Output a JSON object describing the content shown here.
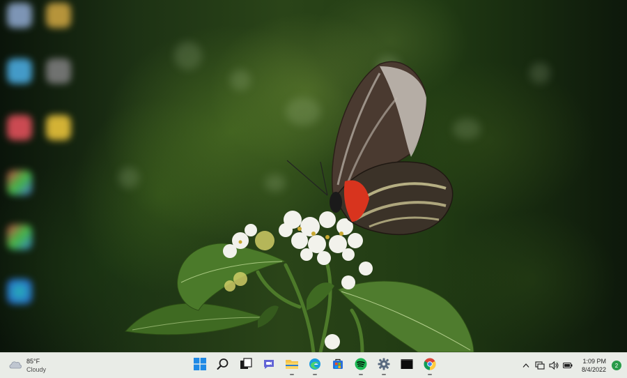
{
  "taskbar": {
    "weather": {
      "temperature": "85°F",
      "condition": "Cloudy",
      "icon": "cloud-icon"
    },
    "apps": [
      {
        "name": "start",
        "icon": "windows-logo-icon",
        "running": false
      },
      {
        "name": "search",
        "icon": "search-icon",
        "running": false
      },
      {
        "name": "task-view",
        "icon": "task-view-icon",
        "running": false
      },
      {
        "name": "chat",
        "icon": "teams-chat-icon",
        "running": false
      },
      {
        "name": "file-explorer",
        "icon": "folder-icon",
        "running": true
      },
      {
        "name": "edge",
        "icon": "edge-icon",
        "running": true
      },
      {
        "name": "store",
        "icon": "store-icon",
        "running": false
      },
      {
        "name": "spotify",
        "icon": "spotify-icon",
        "running": true
      },
      {
        "name": "settings",
        "icon": "gear-icon",
        "running": true
      },
      {
        "name": "terminal",
        "icon": "terminal-icon",
        "running": false
      },
      {
        "name": "chrome",
        "icon": "chrome-icon",
        "running": true
      }
    ],
    "tray": {
      "icons": [
        "chevron-up-icon",
        "network-icon",
        "volume-icon",
        "battery-icon"
      ],
      "time": "1:09 PM",
      "date": "8/4/2022",
      "notification_count": "2"
    }
  },
  "colors": {
    "taskbar_bg": "#e9ece7",
    "accent_blue": "#0f6cbd",
    "spotify_green": "#1db954",
    "notification_green": "#2a9b4a"
  }
}
